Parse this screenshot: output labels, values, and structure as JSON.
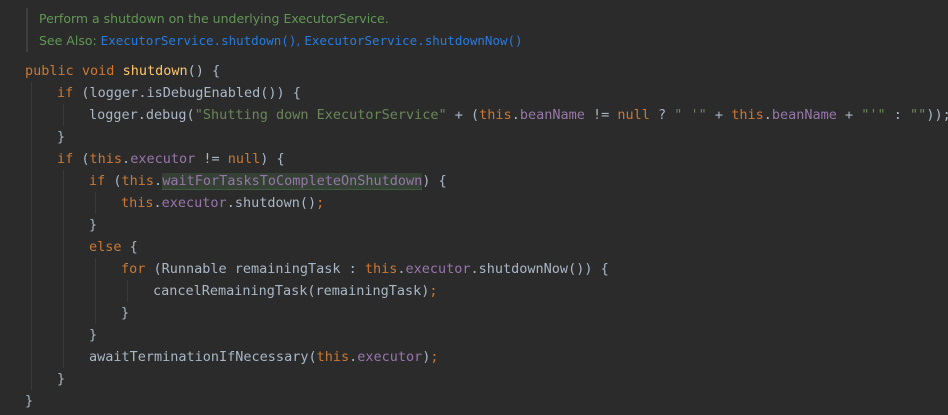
{
  "doc": {
    "summary": "Perform a shutdown on the underlying ExecutorService.",
    "see_also_label": "See Also:",
    "link1": "ExecutorService.shutdown()",
    "separator": ",",
    "link2": "ExecutorService.shutdownNow()"
  },
  "code": {
    "l1": {
      "mod": "public",
      "type": "void",
      "name": "shutdown",
      "rest": "() {"
    },
    "l2": {
      "kw": "if",
      "a": " (",
      "obj": "logger",
      "b": ".isDebugEnabled()) {"
    },
    "l3": {
      "obj": "logger",
      "call": ".debug(",
      "s1": "\"Shutting down ExecutorService\"",
      "p1": " + (",
      "this1": "this",
      "dot1": ".",
      "f1": "beanName",
      "p2": " != ",
      "null": "null",
      "p3": " ? ",
      "s2": "\" '\"",
      "p4": " + ",
      "this2": "this",
      "dot2": ".",
      "f2": "beanName",
      "p5": " + ",
      "s3": "\"'\"",
      "p6": " : ",
      "s4": "\"\"",
      "p7": "));"
    },
    "l4": "}",
    "l5": {
      "kw": "if",
      "a": " (",
      "this": "this",
      "dot": ".",
      "f": "executor",
      "b": " != ",
      "null": "null",
      "c": ") {"
    },
    "l6": {
      "kw": "if",
      "a": " (",
      "this": "this",
      "dot": ".",
      "f": "waitForTasksToCompleteOnShutdown",
      "c": ") {"
    },
    "l7": {
      "this": "this",
      "dot": ".",
      "f": "executor",
      "rest": ".shutdown()",
      "semi": ";"
    },
    "l8": "}",
    "l9": {
      "kw": "else",
      "rest": " {"
    },
    "l10": {
      "kw": "for",
      "a": " (Runnable remainingTask : ",
      "this": "this",
      "dot": ".",
      "f": "executor",
      "c": ".shutdownNow()) {"
    },
    "l11": {
      "call": "cancelRemainingTask(remainingTask)",
      "semi": ";"
    },
    "l12": "}",
    "l13": "}",
    "l14": {
      "call": "awaitTerminationIfNecessary(",
      "this": "this",
      "dot": ".",
      "f": "executor",
      "c": ")",
      "semi": ";"
    },
    "l15": "}",
    "l16": "}"
  }
}
